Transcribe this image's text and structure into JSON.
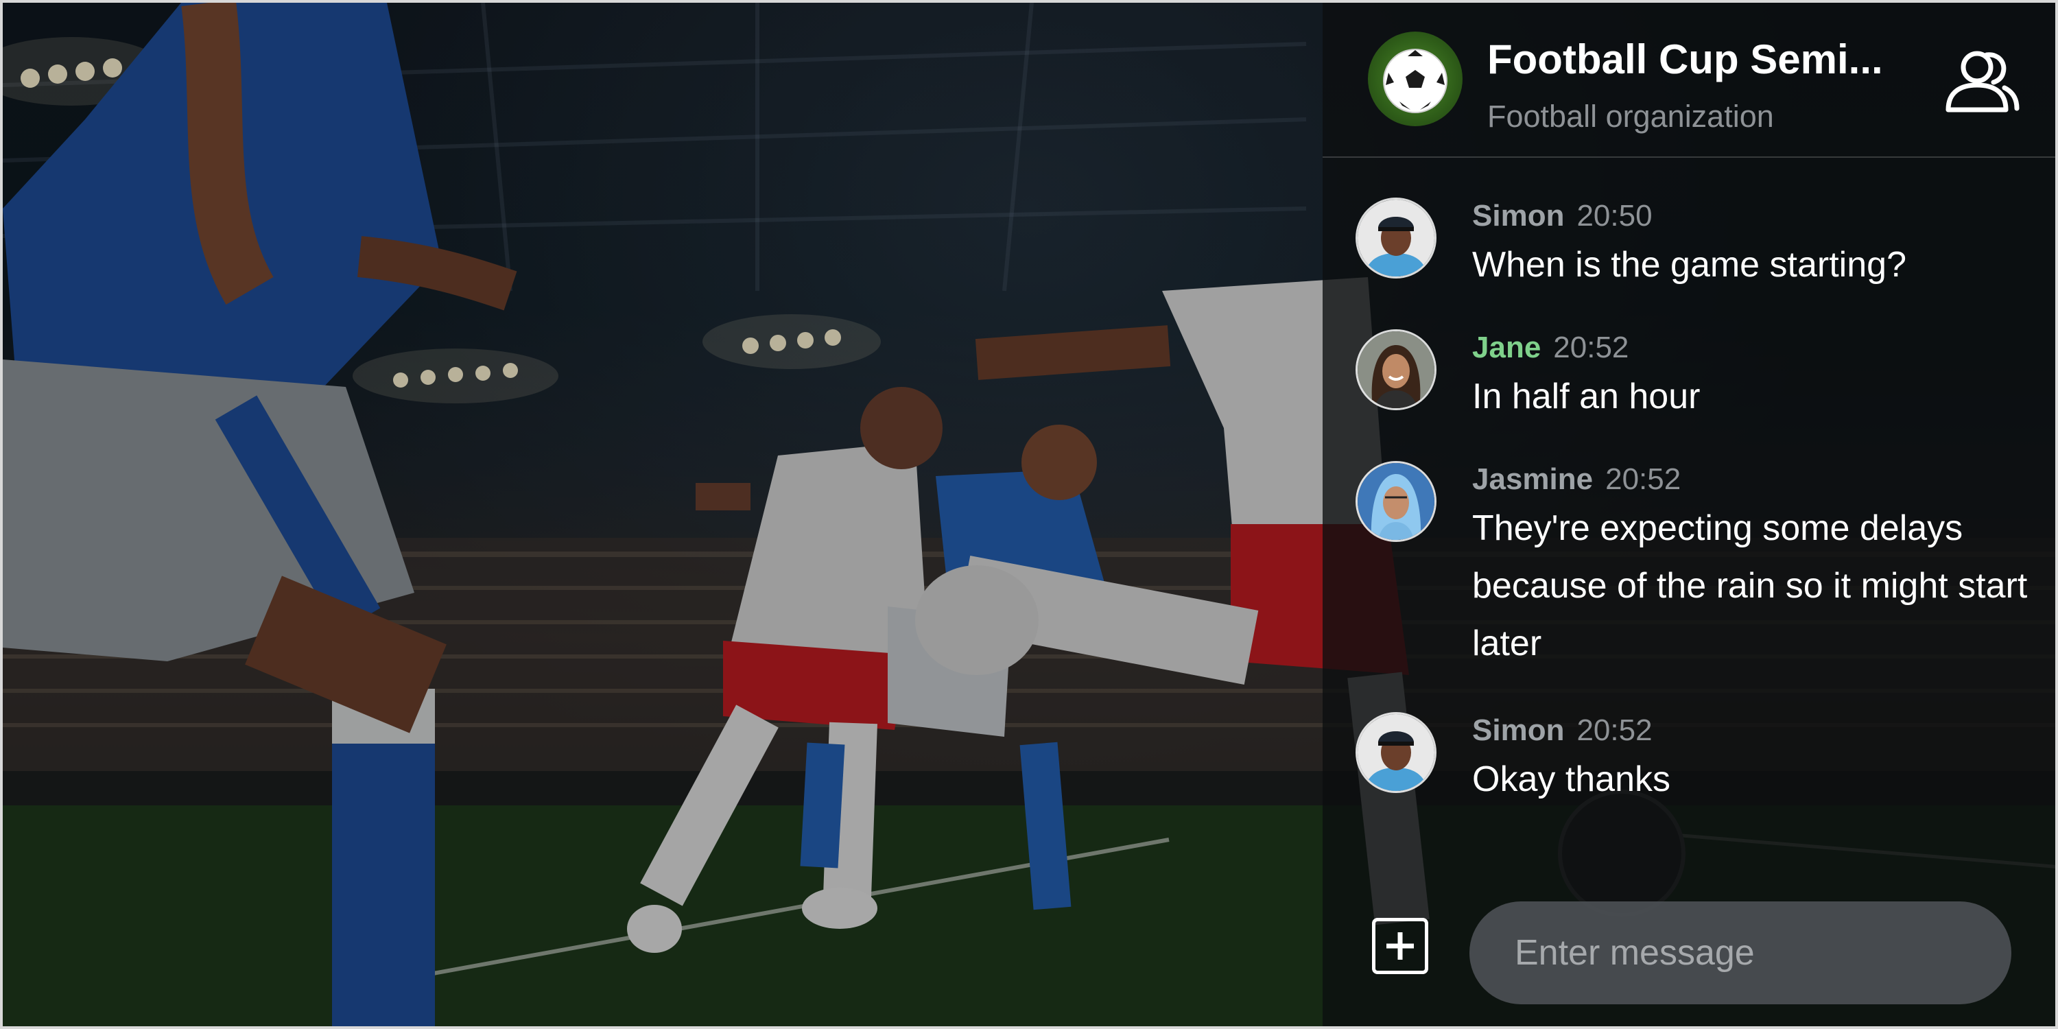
{
  "channel": {
    "title": "Football Cup Semi...",
    "subtitle": "Football organization",
    "avatar_icon": "soccer-ball-icon",
    "members_icon": "users-icon"
  },
  "messages": [
    {
      "author": "Simon",
      "time": "20:50",
      "text": "When is the game starting?",
      "avatar": "simon-avatar",
      "accent": false
    },
    {
      "author": "Jane",
      "time": "20:52",
      "text": "In half an hour",
      "avatar": "jane-avatar",
      "accent": true
    },
    {
      "author": "Jasmine",
      "time": "20:52",
      "text": "They're expecting some delays because of the rain so it might start later",
      "avatar": "jasmine-avatar",
      "accent": false
    },
    {
      "author": "Simon",
      "time": "20:52",
      "text": "Okay thanks",
      "avatar": "simon-avatar",
      "accent": false
    }
  ],
  "composer": {
    "placeholder": "Enter message",
    "value": "",
    "attach_icon": "plus-square-icon"
  },
  "colors": {
    "accent_author": "#7fd18b",
    "muted_text": "#8e9296",
    "panel_bg": "rgba(12,14,16,0.78)",
    "input_bg": "#4e5256"
  }
}
